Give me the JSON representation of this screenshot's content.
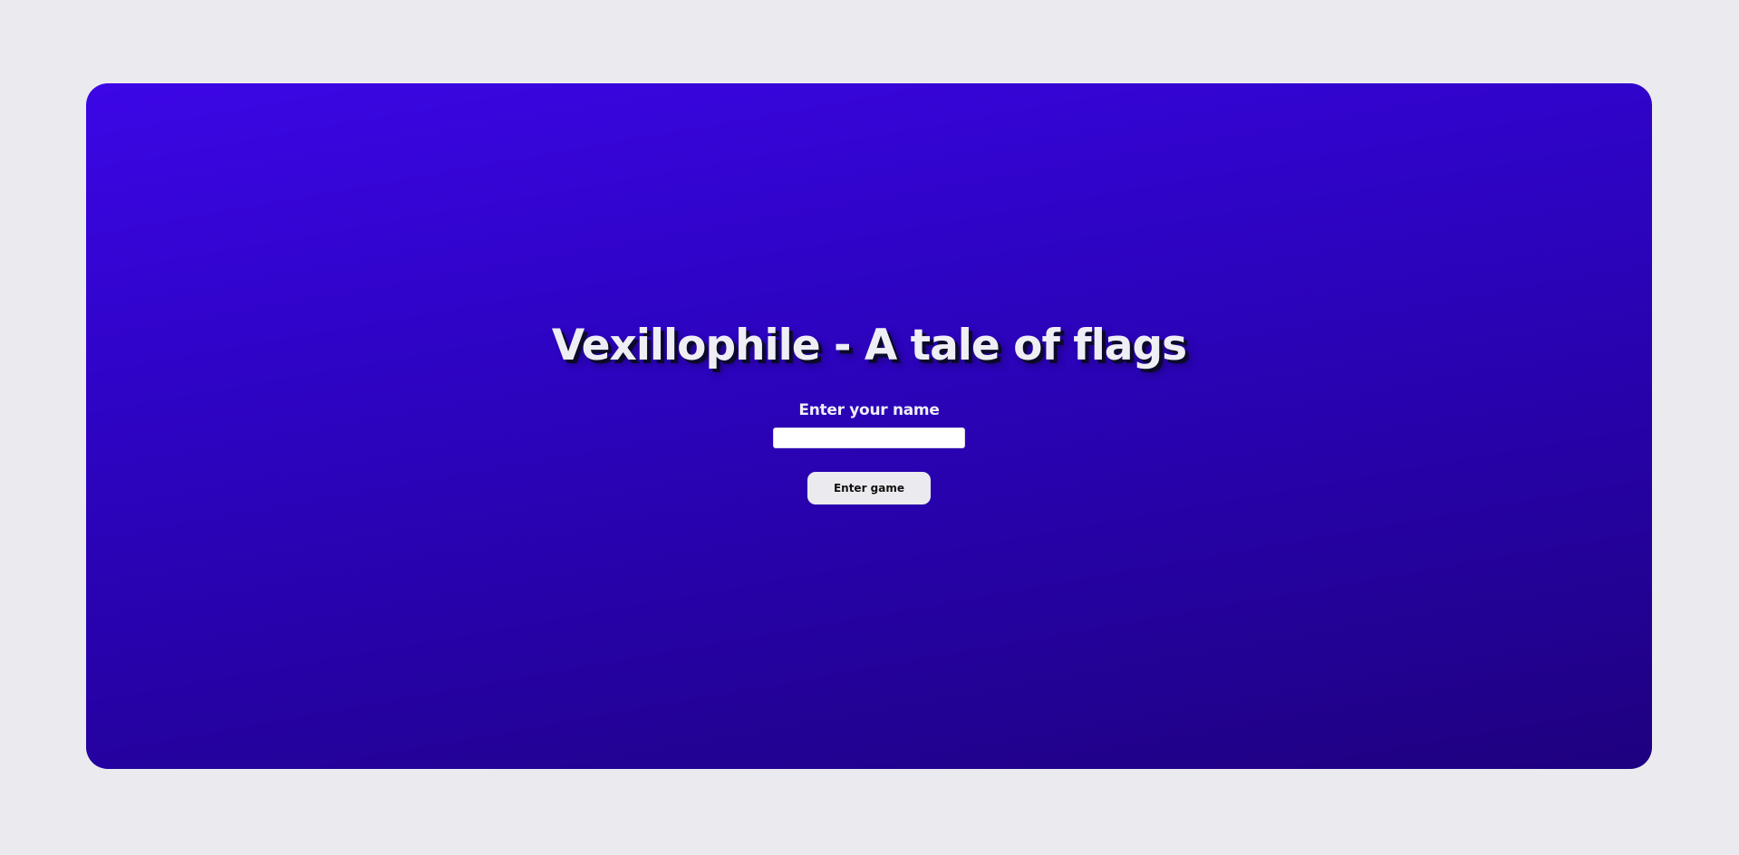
{
  "page": {
    "background_color": "#ebebef",
    "card_gradient": [
      "#3c06e6",
      "#1e017f"
    ]
  },
  "hero": {
    "title": "Vexillophile - A tale of flags"
  },
  "form": {
    "name_label": "Enter your name",
    "name_value": "",
    "name_placeholder": "",
    "submit_label": "Enter game"
  }
}
